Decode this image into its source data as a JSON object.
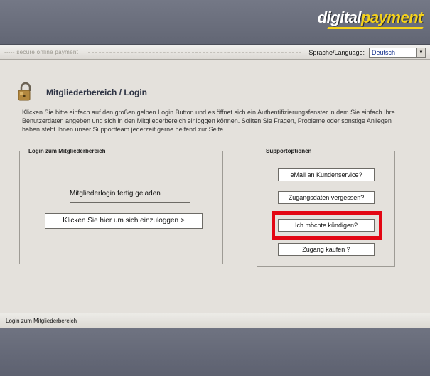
{
  "brand": {
    "part_a": "digital",
    "part_b": "payment"
  },
  "toolbar": {
    "tagline": "----- secure online payment",
    "language_label": "Sprache/Language:",
    "language_value": "Deutsch"
  },
  "page": {
    "title": "Mitgliederbereich / Login",
    "intro": "Klicken Sie bitte einfach auf den großen gelben Login Button und es öffnet sich ein Authentifizierungsfenster in dem Sie einfach Ihre Benutzerdaten angeben und sich in den Mitgliederbereich einloggen können. Sollten Sie Fragen, Probleme oder sonstige Anliegen haben steht Ihnen unser Supportteam jederzeit gerne helfend zur Seite."
  },
  "login_box": {
    "legend": "Login zum Mitgliederbereich",
    "status": "Mitgliederlogin fertig geladen",
    "button": "Klicken Sie hier um sich einzuloggen >"
  },
  "support_box": {
    "legend": "Supportoptionen",
    "buttons": [
      {
        "label": "eMail an Kundenservice?"
      },
      {
        "label": "Zugangsdaten vergessen?"
      },
      {
        "label": "Ich möchte kündigen?"
      },
      {
        "label": "Zugang kaufen ?"
      }
    ]
  },
  "statusbar": {
    "text": "Login zum Mitgliederbereich"
  },
  "colors": {
    "accent": "#f5d21b",
    "highlight": "#e30613",
    "header": "#6a6e7c"
  }
}
